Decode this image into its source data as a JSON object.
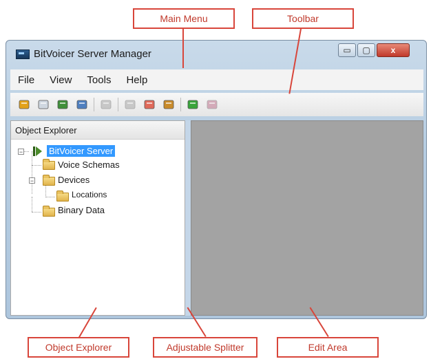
{
  "callouts": {
    "main_menu": "Main Menu",
    "toolbar": "Toolbar",
    "object_explorer": "Object Explorer",
    "adjustable_splitter": "Adjustable Splitter",
    "edit_area": "Edit Area"
  },
  "window": {
    "title": "BitVoicer Server Manager",
    "controls": {
      "minimize": "▭",
      "maximize": "▢",
      "close": "x"
    }
  },
  "menu": [
    "File",
    "View",
    "Tools",
    "Help"
  ],
  "toolbar_icons": [
    {
      "name": "open-folder-icon",
      "enabled": true,
      "color": "#e3a21a"
    },
    {
      "name": "new-document-icon",
      "enabled": true,
      "color": "#cfd7e0"
    },
    {
      "name": "pin-icon",
      "enabled": true,
      "color": "#3f8f3a"
    },
    {
      "name": "chart-icon",
      "enabled": true,
      "color": "#4f7fbf"
    },
    {
      "name": "delete-icon",
      "enabled": false,
      "color": "#9a9a9a"
    },
    {
      "name": "play-icon",
      "enabled": false,
      "color": "#9a9a9a"
    },
    {
      "name": "bulb-icon",
      "enabled": true,
      "color": "#e06a5a"
    },
    {
      "name": "properties-icon",
      "enabled": true,
      "color": "#c98b2a"
    },
    {
      "name": "green-square-icon",
      "enabled": true,
      "color": "#39a43b"
    },
    {
      "name": "eraser-icon",
      "enabled": false,
      "color": "#b45a7a"
    }
  ],
  "explorer": {
    "header": "Object Explorer",
    "nodes": {
      "root": "BitVoicer Server",
      "voice_schemas": "Voice Schemas",
      "devices": "Devices",
      "locations": "Locations",
      "binary_data": "Binary Data"
    },
    "selected": "BitVoicer Server"
  }
}
